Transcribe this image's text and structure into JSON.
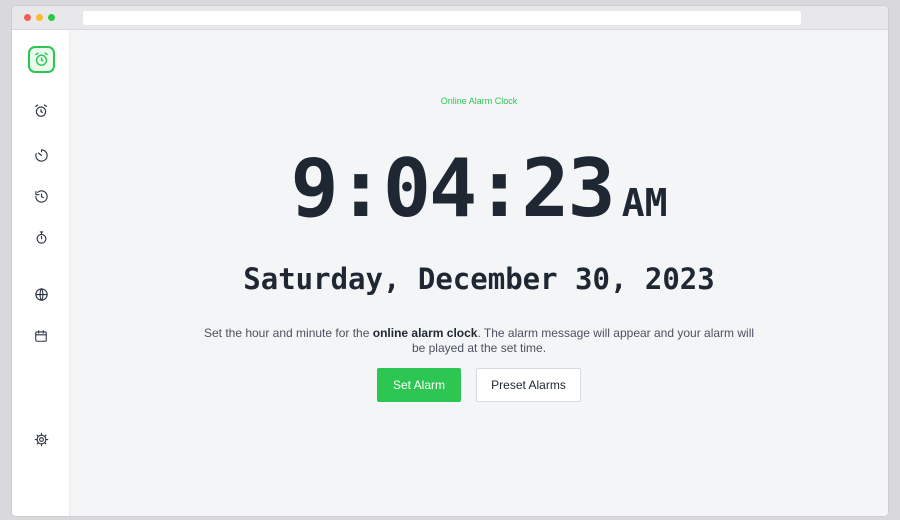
{
  "sidebar": {
    "logo_icon": "alarm-clock-icon",
    "items": [
      {
        "name": "alarm-clock-icon"
      },
      {
        "name": "timer-icon"
      },
      {
        "name": "countdown-icon"
      },
      {
        "name": "stopwatch-icon"
      },
      {
        "name": "globe-icon"
      },
      {
        "name": "calendar-icon"
      },
      {
        "name": "settings-icon"
      }
    ]
  },
  "main": {
    "tagline": "Online Alarm Clock",
    "time": "9:04:23",
    "ampm": "AM",
    "date": "Saturday, December 30, 2023",
    "description": {
      "before": "Set the hour and minute for the ",
      "bold": "online alarm clock",
      "after": ". The alarm message will appear and your alarm will be played at the set time."
    },
    "buttons": {
      "set_alarm": "Set Alarm",
      "preset_alarms": "Preset Alarms"
    }
  },
  "colors": {
    "accent": "#2dc653",
    "text_dark": "#1f2733",
    "background": "#f4f5f7"
  }
}
